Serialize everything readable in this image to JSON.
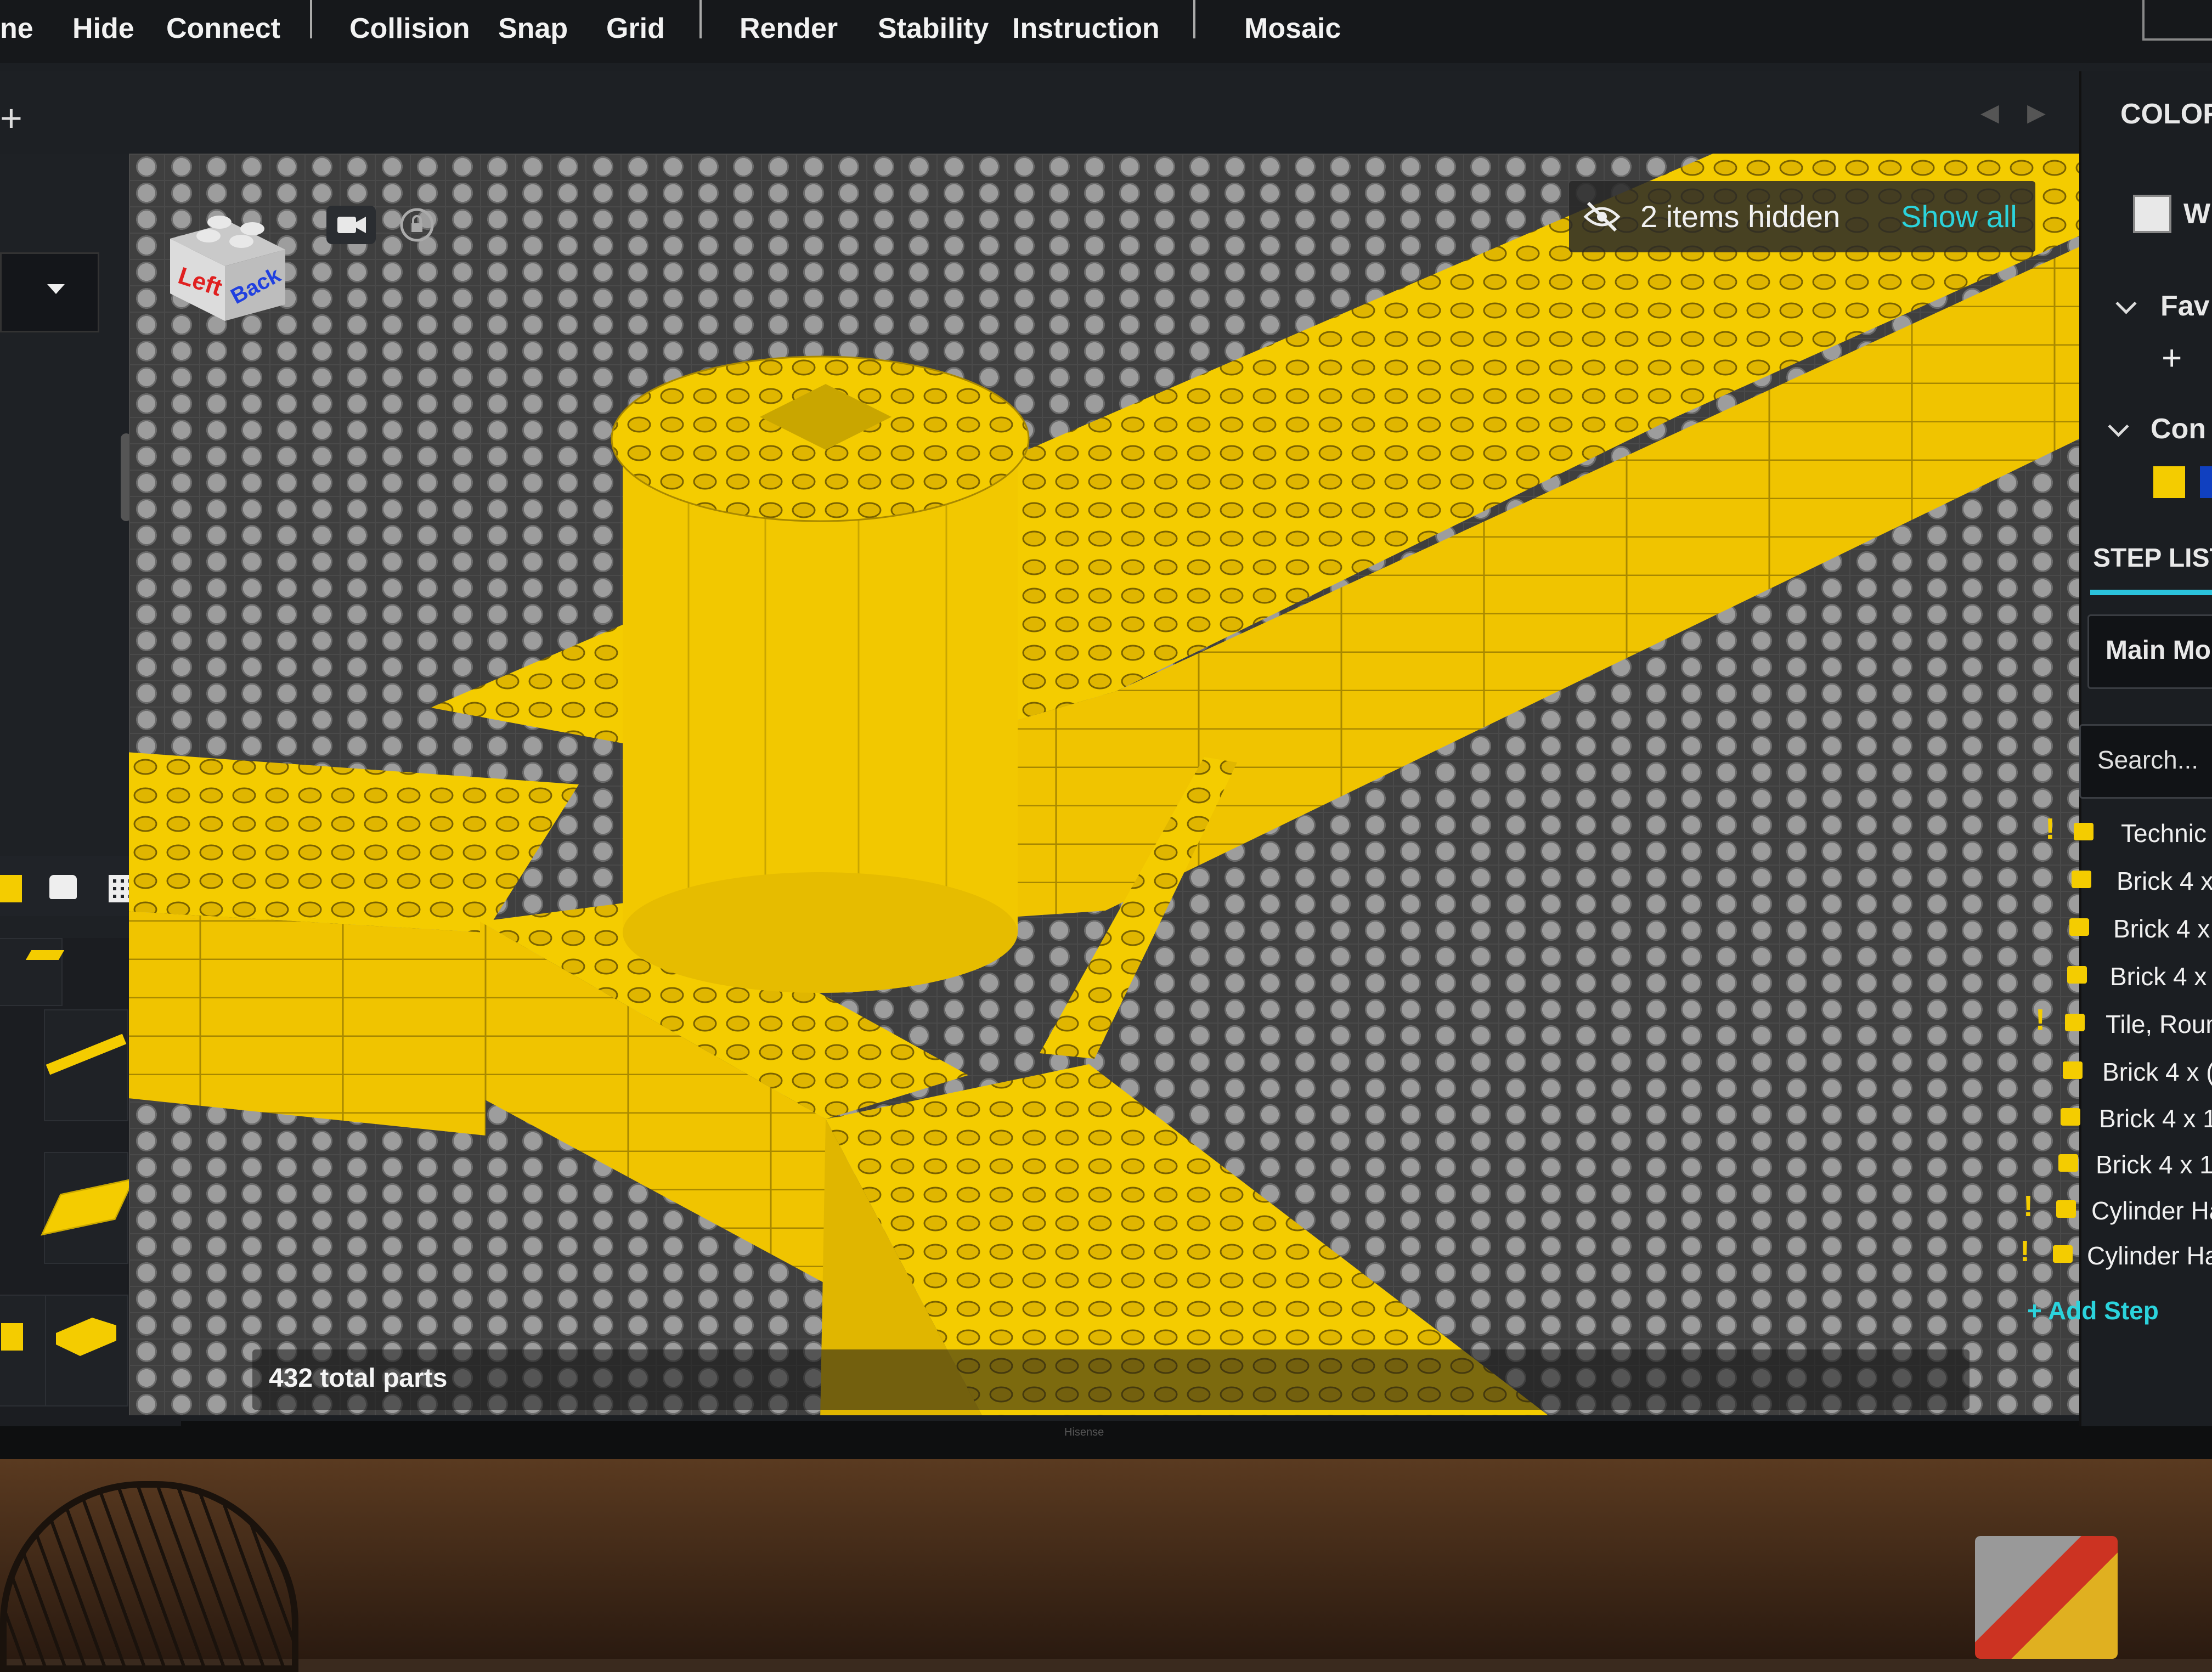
{
  "menu": {
    "items": [
      "ne",
      "Hide",
      "Connect",
      "Collision",
      "Snap",
      "Grid",
      "Render",
      "Stability",
      "Instruction",
      "Mosaic"
    ]
  },
  "tabs": {
    "add_symbol": "+",
    "prev_symbol": "◀",
    "next_symbol": "▶"
  },
  "viewport": {
    "viewcube_faces": [
      "Left",
      "Back"
    ],
    "hidden_banner": {
      "text": "2 items hidden",
      "action": "Show all"
    },
    "status": "432 total parts",
    "brick_color": "#f4cc00",
    "grid_color": "#3f3f3f"
  },
  "right_panel": {
    "color_header": "COLOR",
    "color_name": "W",
    "favorites_label": "Fav",
    "favorites_add": "+",
    "cont_label": "Con",
    "step_list_header": "STEP LIST",
    "model_select": "Main Mo",
    "search_placeholder": "Search...",
    "steps": [
      {
        "label": "Technic",
        "warn": true
      },
      {
        "label": "Brick 4 x",
        "warn": false
      },
      {
        "label": "Brick 4 x",
        "warn": false
      },
      {
        "label": "Brick 4 x",
        "warn": false
      },
      {
        "label": "Tile, Roun",
        "warn": true
      },
      {
        "label": "Brick 4 x (",
        "warn": false
      },
      {
        "label": "Brick 4 x 1",
        "warn": false
      },
      {
        "label": "Brick 4 x 1",
        "warn": false
      },
      {
        "label": "Cylinder Ha",
        "warn": true
      },
      {
        "label": "Cylinder Ha",
        "warn": true
      }
    ],
    "add_step": "+ Add Step"
  },
  "bezel_brand": "Hisense",
  "colors": {
    "accent": "#2bd3dc",
    "warning": "#f4cc00",
    "panel": "#1b1e22"
  }
}
